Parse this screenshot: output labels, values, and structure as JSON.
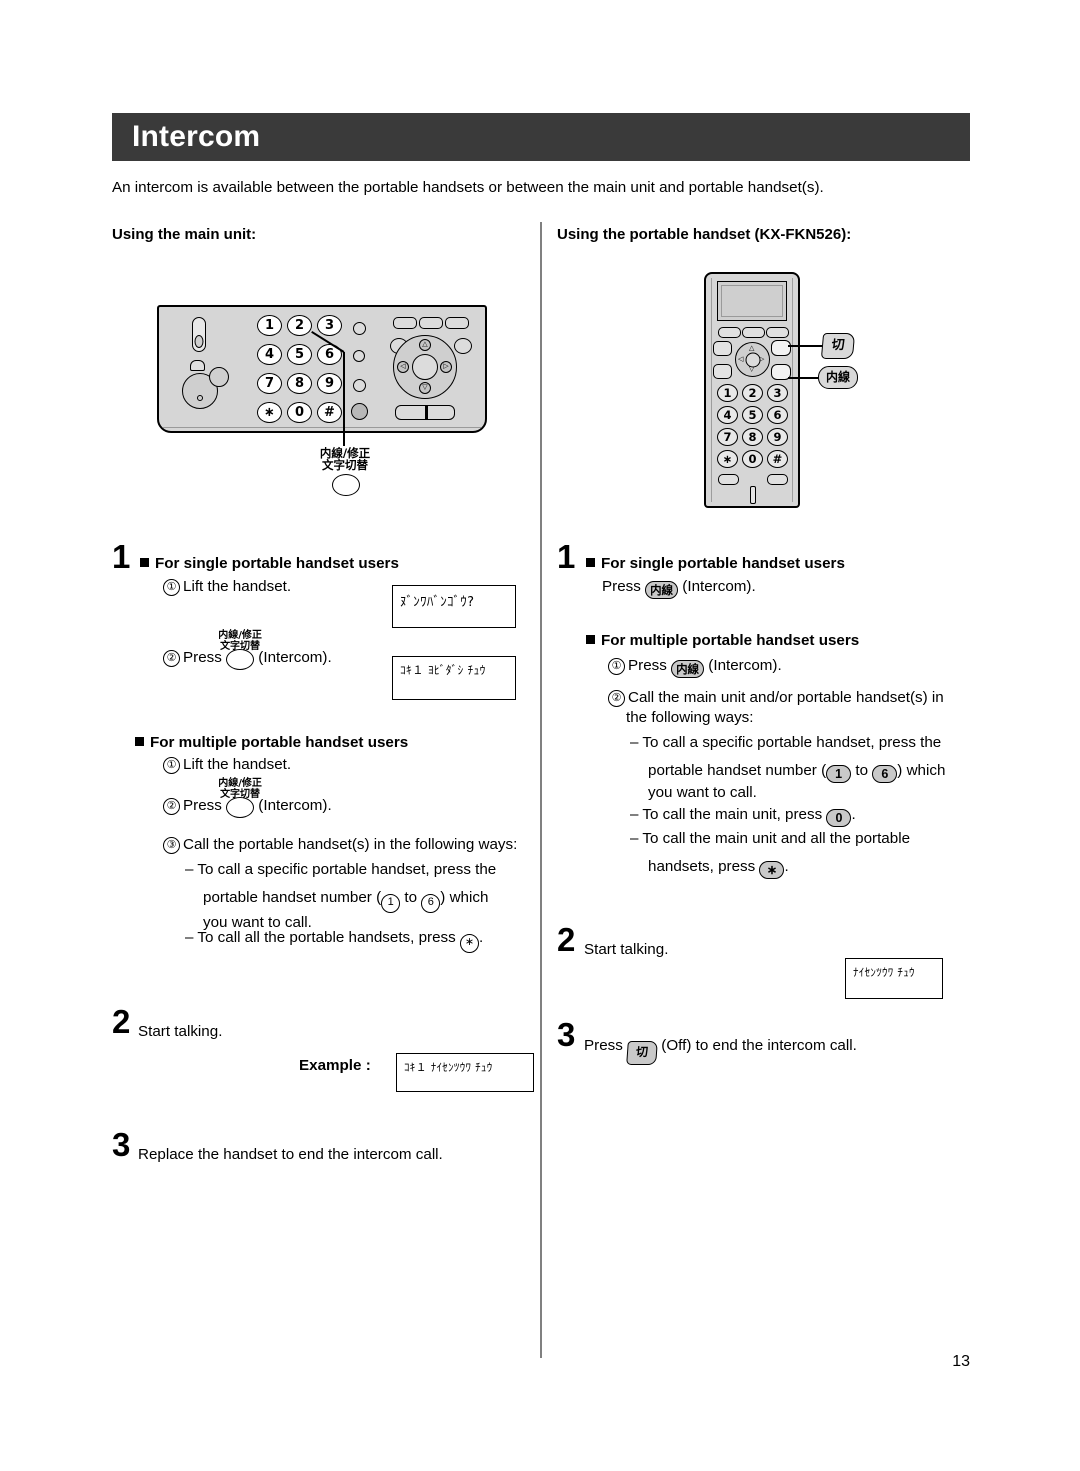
{
  "header": {
    "title": "Intercom"
  },
  "intro": "An intercom is available between the portable handsets or between the main unit and portable handset(s).",
  "columns": {
    "left": {
      "heading": "Using the main unit:",
      "illustration": {
        "name": "main-unit",
        "dial_keys": [
          "1",
          "2",
          "3",
          "4",
          "5",
          "6",
          "7",
          "8",
          "9",
          "∗",
          "0",
          "#"
        ],
        "callout_label_line1": "内線/修正",
        "callout_label_line2": "文字切替"
      },
      "step1": {
        "number": "1",
        "single_heading": "For single portable handset users",
        "single_item1_num": "①",
        "single_item1": "Lift the handset.",
        "single_item2_num": "②",
        "single_item2_pre": "Press",
        "single_item2_post": "(Intercom).",
        "multi_heading": "For multiple portable handset users",
        "multi_item1_num": "①",
        "multi_item1": "Lift the handset.",
        "multi_item2_num": "②",
        "multi_item2_pre": "Press",
        "multi_item2_post": "(Intercom).",
        "multi_item3_num": "③",
        "multi_item3": "Call the portable handset(s) in the following ways:",
        "dash1_a": "– To call a specific portable handset, press the",
        "dash1_b_pre": "portable handset number (",
        "dash1_key_from": "1",
        "dash1_mid": "to",
        "dash1_key_to": "6",
        "dash1_b_post": ") which",
        "dash1_c": "you want to call.",
        "dash2_pre": "– To call all the portable handsets, press",
        "dash2_key": "∗",
        "dash2_post": "."
      },
      "key_label_line1": "内線/修正",
      "key_label_line2": "文字切替",
      "lcd1": "ﾇﾞﾝﾜﾊﾞﾝｺﾞｳ?",
      "lcd2": "ｺｷ１ ﾖﾋﾞﾀﾞｼ ﾁｭｳ",
      "step2": {
        "number": "2",
        "text": "Start talking."
      },
      "example_label": "Example :",
      "lcd_example": "ｺｷ１ ﾅｲｾﾝﾂｳﾜ ﾁｭｳ",
      "step3": {
        "number": "3",
        "text": "Replace the handset to end the intercom call."
      }
    },
    "right": {
      "heading": "Using the portable handset (KX-FKN526):",
      "illustration": {
        "name": "portable-handset",
        "dial_keys": [
          "1",
          "2",
          "3",
          "4",
          "5",
          "6",
          "7",
          "8",
          "9",
          "∗",
          "0",
          "#"
        ],
        "callout_off": "切",
        "callout_intercom": "内線"
      },
      "step1": {
        "number": "1",
        "single_heading": "For single portable handset users",
        "single_pre": "Press",
        "single_key": "内線",
        "single_post": "(Intercom).",
        "multi_heading": "For multiple portable handset users",
        "multi_item1_num": "①",
        "multi_item1_pre": "Press",
        "multi_item1_key": "内線",
        "multi_item1_post": "(Intercom).",
        "multi_item2_num": "②",
        "multi_item2_a": "Call the main unit and/or portable handset(s) in",
        "multi_item2_b": "the following ways:",
        "dash1_a": "– To call a specific portable handset, press the",
        "dash1_b_pre": "portable handset number (",
        "dash1_key_from": "1",
        "dash1_mid": "to",
        "dash1_key_to": "6",
        "dash1_b_post": ") which",
        "dash1_c": "you want to call.",
        "dash2_pre": "– To call the main unit, press",
        "dash2_key": "0",
        "dash2_post": ".",
        "dash3_a": "– To call the main unit and all the portable",
        "dash3_b_pre": "handsets, press",
        "dash3_key": "∗",
        "dash3_b_post": "."
      },
      "step2": {
        "number": "2",
        "text": "Start talking."
      },
      "lcd_talking": "ﾅｲｾﾝﾂｳﾜ ﾁｭｳ",
      "step3": {
        "number": "3",
        "pre": "Press",
        "key": "切",
        "post": "(Off) to end the intercom call."
      }
    }
  },
  "page_number": "13",
  "colors": {
    "header_bar": "#3a3a3a",
    "divider": "#808080",
    "device_body": "#d6d6d6",
    "key_gray": "#c9c9c9"
  }
}
